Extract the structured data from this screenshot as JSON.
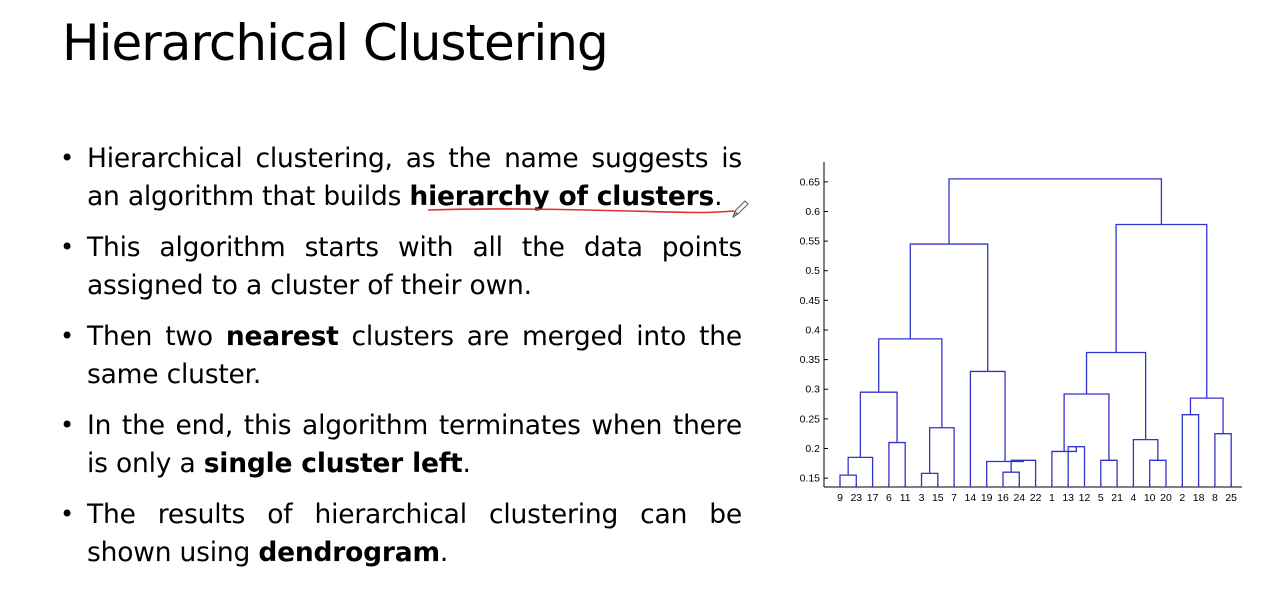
{
  "slide": {
    "title": "Hierarchical Clustering",
    "bullets": [
      {
        "parts": [
          {
            "text": "Hierarchical clustering, as the name suggests is an algorithm that builds ",
            "bold": false
          },
          {
            "text": "hierarchy of clusters",
            "bold": true,
            "annotated": true
          },
          {
            "text": ".",
            "bold": false
          }
        ]
      },
      {
        "parts": [
          {
            "text": "This algorithm starts with all the data points assigned to a cluster of their own.",
            "bold": false
          }
        ]
      },
      {
        "parts": [
          {
            "text": "Then two ",
            "bold": false
          },
          {
            "text": "nearest",
            "bold": true
          },
          {
            "text": " clusters are merged into the same cluster.",
            "bold": false
          }
        ]
      },
      {
        "parts": [
          {
            "text": "In the end, this algorithm terminates when there is only a ",
            "bold": false
          },
          {
            "text": "single cluster left",
            "bold": true
          },
          {
            "text": ".",
            "bold": false
          }
        ]
      },
      {
        "parts": [
          {
            "text": "The results of hierarchical clustering can be shown using ",
            "bold": false
          },
          {
            "text": "dendrogram",
            "bold": true
          },
          {
            "text": ".",
            "bold": false
          }
        ]
      }
    ],
    "bullet_glyph": "•",
    "annotation_color": "#e03030",
    "pen_icon": "pencil-icon"
  },
  "chart_data": {
    "type": "dendrogram",
    "leaves": [
      "9",
      "23",
      "17",
      "6",
      "11",
      "3",
      "15",
      "7",
      "14",
      "19",
      "16",
      "24",
      "22",
      "1",
      "13",
      "12",
      "5",
      "21",
      "4",
      "10",
      "20",
      "2",
      "18",
      "8",
      "25"
    ],
    "ytick_labels": [
      "0.15",
      "0.2",
      "0.25",
      "0.3",
      "0.35",
      "0.4",
      "0.45",
      "0.5",
      "0.55",
      "0.6",
      "0.65"
    ],
    "yticks": [
      0.15,
      0.2,
      0.25,
      0.3,
      0.35,
      0.4,
      0.45,
      0.5,
      0.55,
      0.6,
      0.65
    ],
    "ylim": [
      0.135,
      0.67
    ],
    "line_color": "#3333cc",
    "merges": [
      {
        "a": "9",
        "b": "23",
        "h": 0.155
      },
      {
        "a": "m0",
        "b": "17",
        "h": 0.185
      },
      {
        "a": "6",
        "b": "11",
        "h": 0.21
      },
      {
        "a": "m1",
        "b": "m2",
        "h": 0.295
      },
      {
        "a": "3",
        "b": "15",
        "h": 0.158
      },
      {
        "a": "m4",
        "b": "7",
        "h": 0.235
      },
      {
        "a": "m3",
        "b": "m5",
        "h": 0.385
      },
      {
        "a": "16",
        "b": "24",
        "h": 0.16
      },
      {
        "a": "m7",
        "b": "22",
        "h": 0.18
      },
      {
        "a": "19",
        "b": "m8",
        "h": 0.178
      },
      {
        "a": "14",
        "b": "m9",
        "h": 0.33
      },
      {
        "a": "m6",
        "b": "m10",
        "h": 0.545
      },
      {
        "a": "13",
        "b": "12",
        "h": 0.203
      },
      {
        "a": "1",
        "b": "m12",
        "h": 0.195
      },
      {
        "a": "5",
        "b": "21",
        "h": 0.18
      },
      {
        "a": "m13",
        "b": "m14",
        "h": 0.292
      },
      {
        "a": "10",
        "b": "20",
        "h": 0.18
      },
      {
        "a": "4",
        "b": "m16",
        "h": 0.215
      },
      {
        "a": "m15",
        "b": "m17",
        "h": 0.362
      },
      {
        "a": "2",
        "b": "18",
        "h": 0.257
      },
      {
        "a": "8",
        "b": "25",
        "h": 0.225
      },
      {
        "a": "m19",
        "b": "m20",
        "h": 0.285
      },
      {
        "a": "m18",
        "b": "m21",
        "h": 0.578
      },
      {
        "a": "m11",
        "b": "m22",
        "h": 0.655
      }
    ]
  }
}
